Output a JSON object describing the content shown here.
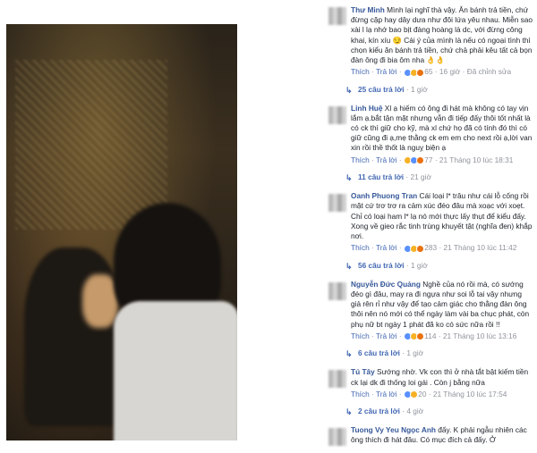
{
  "comments": [
    {
      "name": "Thư Minh",
      "text": " Mình lại nghĩ thà vậy. Ăn bánh trả tiền, chứ đừng cặp hay dây dưa như đôi lứa yêu nhau. Miễn sao xài l lạ nhớ bao bịt đàng hoàng là dc, với đừng công khai, kín xíu 😏 Cái ý của mình là nếu có ngoại tình thì chọn kiểu ăn bánh trả tiền, chứ chả phải kêu tất cả bọn đàn ông đi bia ôm nha 👌👌",
      "like": "Thích",
      "reply": "Trả lời",
      "count": "65",
      "time": "16 giờ",
      "edited": "Đã chỉnh sửa",
      "replies": "25 câu trả lời",
      "replies_time": "1 giờ"
    },
    {
      "name": "Linh Huệ",
      "text": " Xl ạ hiếm có ông đi hát mà không có tay vịn lắm ạ.bắt tận mặt nhưng vẫn đi tiếp đấy thôi tốt nhất là có ck thì giữ cho kỹ, mà xl chứ họ đã có tính đó thì có giữ cũng đi ạ,mẹ thằng ck em em cho next rồi ạ,lời van xin rồi thề thốt là nguỵ biện ạ",
      "like": "Thích",
      "reply": "Trả lời",
      "count": "77",
      "time": "21 Tháng 10 lúc 18:31",
      "replies": "11 câu trả lời",
      "replies_time": "21 giờ"
    },
    {
      "name": "Oanh Phuong Tran",
      "text": " Cái loại l* trâu như cái lỗ cống rồi mặt cứ trơ trơ ra cảm xúc đéo đâu mà xoạc với xoẹt. Chỉ có loại ham l* lạ nó mới thực lấy thụt để kiểu đấy. Xong về gieo rắc tinh trùng khuyết tật (nghĩa đen) khắp nơi.",
      "like": "Thích",
      "reply": "Trả lời",
      "count": "283",
      "time": "21 Tháng 10 lúc 11:42",
      "replies": "56 câu trả lời",
      "replies_time": "1 giờ"
    },
    {
      "name": "Nguyễn Đức Quảng",
      "text": " Nghề của nó rồi mà, có sướng đéo gì đâu, may ra đi ngựa như soi lỗ tai vậy nhưng giả rên rỉ như vậy để tạo cảm giác cho thằng đàn ông thôi nên nó mới có thể ngày làm vài ba chục phát, còn phụ nữ bt ngày 1 phát đã ko có sức nữa rồi !!",
      "like": "Thích",
      "reply": "Trả lời",
      "count": "114",
      "time": "21 Tháng 10 lúc 13:16",
      "replies": "6 câu trả lời",
      "replies_time": "1 giờ"
    },
    {
      "name": "Tú Tây",
      "text": " Sướng nhờ. Vk con thì ở nhà tắt bật kiếm tiền ck lại dk đi thống loi gái . Còn j bằng nữa",
      "like": "Thích",
      "reply": "Trả lời",
      "count": "20",
      "time": "21 Tháng 10 lúc 17:54",
      "replies": "2 câu trả lời",
      "replies_time": "4 giờ"
    },
    {
      "name": "Tuong Vy Yeu",
      "name2": "Ngọc Anh",
      "text": " đấy. K phải ngẫu nhiên các ông thích đi hát đâu. Có mục đích cả đấy. Ở"
    }
  ],
  "icons": {
    "reply_arrow": "↳",
    "dot": "·"
  }
}
